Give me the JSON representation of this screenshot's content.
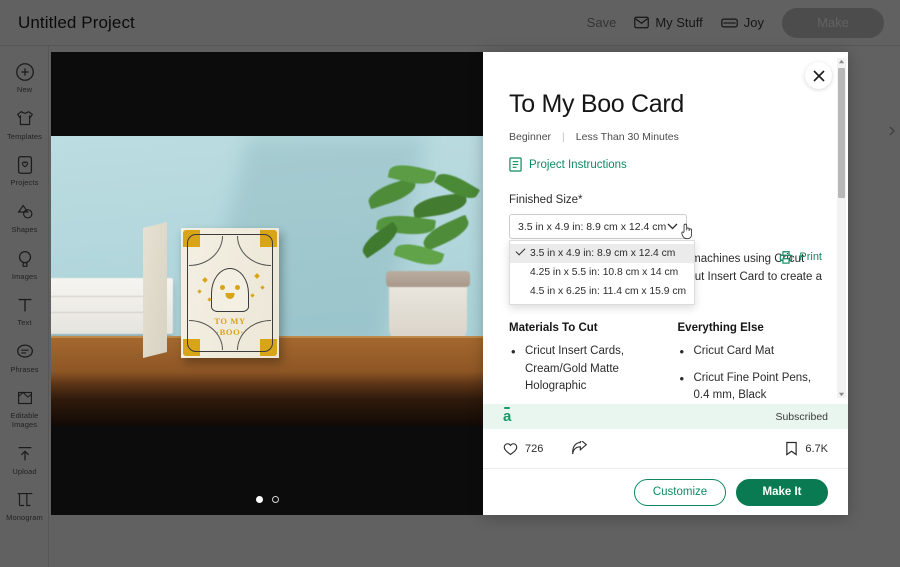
{
  "header": {
    "project_title": "Untitled Project",
    "save_label": "Save",
    "my_stuff_label": "My Stuff",
    "machine_label": "Joy",
    "make_label": "Make"
  },
  "sidebar": {
    "items": [
      {
        "label": "New",
        "icon": "plus-circle-icon"
      },
      {
        "label": "Templates",
        "icon": "shirt-icon"
      },
      {
        "label": "Projects",
        "icon": "project-card-icon"
      },
      {
        "label": "Shapes",
        "icon": "shapes-icon"
      },
      {
        "label": "Images",
        "icon": "image-tag-icon"
      },
      {
        "label": "Text",
        "icon": "text-icon"
      },
      {
        "label": "Phrases",
        "icon": "speech-bubble-icon"
      },
      {
        "label": "Editable Images",
        "icon": "editable-image-icon"
      },
      {
        "label": "Upload",
        "icon": "upload-icon"
      },
      {
        "label": "Monogram",
        "icon": "monogram-icon"
      }
    ]
  },
  "preview": {
    "alt": "Cream card with ghost and spider webs standing on a wooden table",
    "card_text_line1": "TO MY",
    "card_text_line2": "·BOO·",
    "dots": [
      {
        "state": "active"
      },
      {
        "state": "idle"
      }
    ]
  },
  "modal": {
    "close_label": "×",
    "title": "To My Boo Card",
    "difficulty": "Beginner",
    "separator": "|",
    "duration": "Less Than 30 Minutes",
    "instructions_label": "Project Instructions",
    "print_label": "Print",
    "size_field_label": "Finished Size*",
    "size_selected": "3.5 in x 4.9 in: 8.9 cm x 12.4 cm",
    "size_options": [
      {
        "label": "3.5 in x 4.9 in: 8.9 cm x 12.4 cm",
        "selected": true
      },
      {
        "label": "4.25 in x 5.5 in: 10.8 cm x 14 cm",
        "selected": false
      },
      {
        "label": "4.5 in x 6.25 in: 11.4 cm x 15.9 cm",
        "selected": false
      }
    ],
    "description": "Make cards with your Cricut cutting machines using Cricut Insert Cards. This project cuts a Cricut Insert Card to create a Halloween card.",
    "materials_to_cut_heading": "Materials To Cut",
    "materials_to_cut": [
      "Cricut Insert Cards, Cream/Gold Matte Holographic"
    ],
    "everything_else_heading": "Everything Else",
    "everything_else": [
      "Cricut Card Mat",
      "Cricut Fine Point Pens, 0.4 mm, Black"
    ],
    "access_logo": "a",
    "subscription_status": "Subscribed",
    "likes_count": "726",
    "bookmarks_count": "6.7K",
    "customize_label": "Customize",
    "make_it_label": "Make It"
  },
  "colors": {
    "brand_green": "#0f8a5f",
    "make_it_green": "#0a7a52",
    "access_strip": "#e9f5ef",
    "card_gold": "#d8a418"
  }
}
